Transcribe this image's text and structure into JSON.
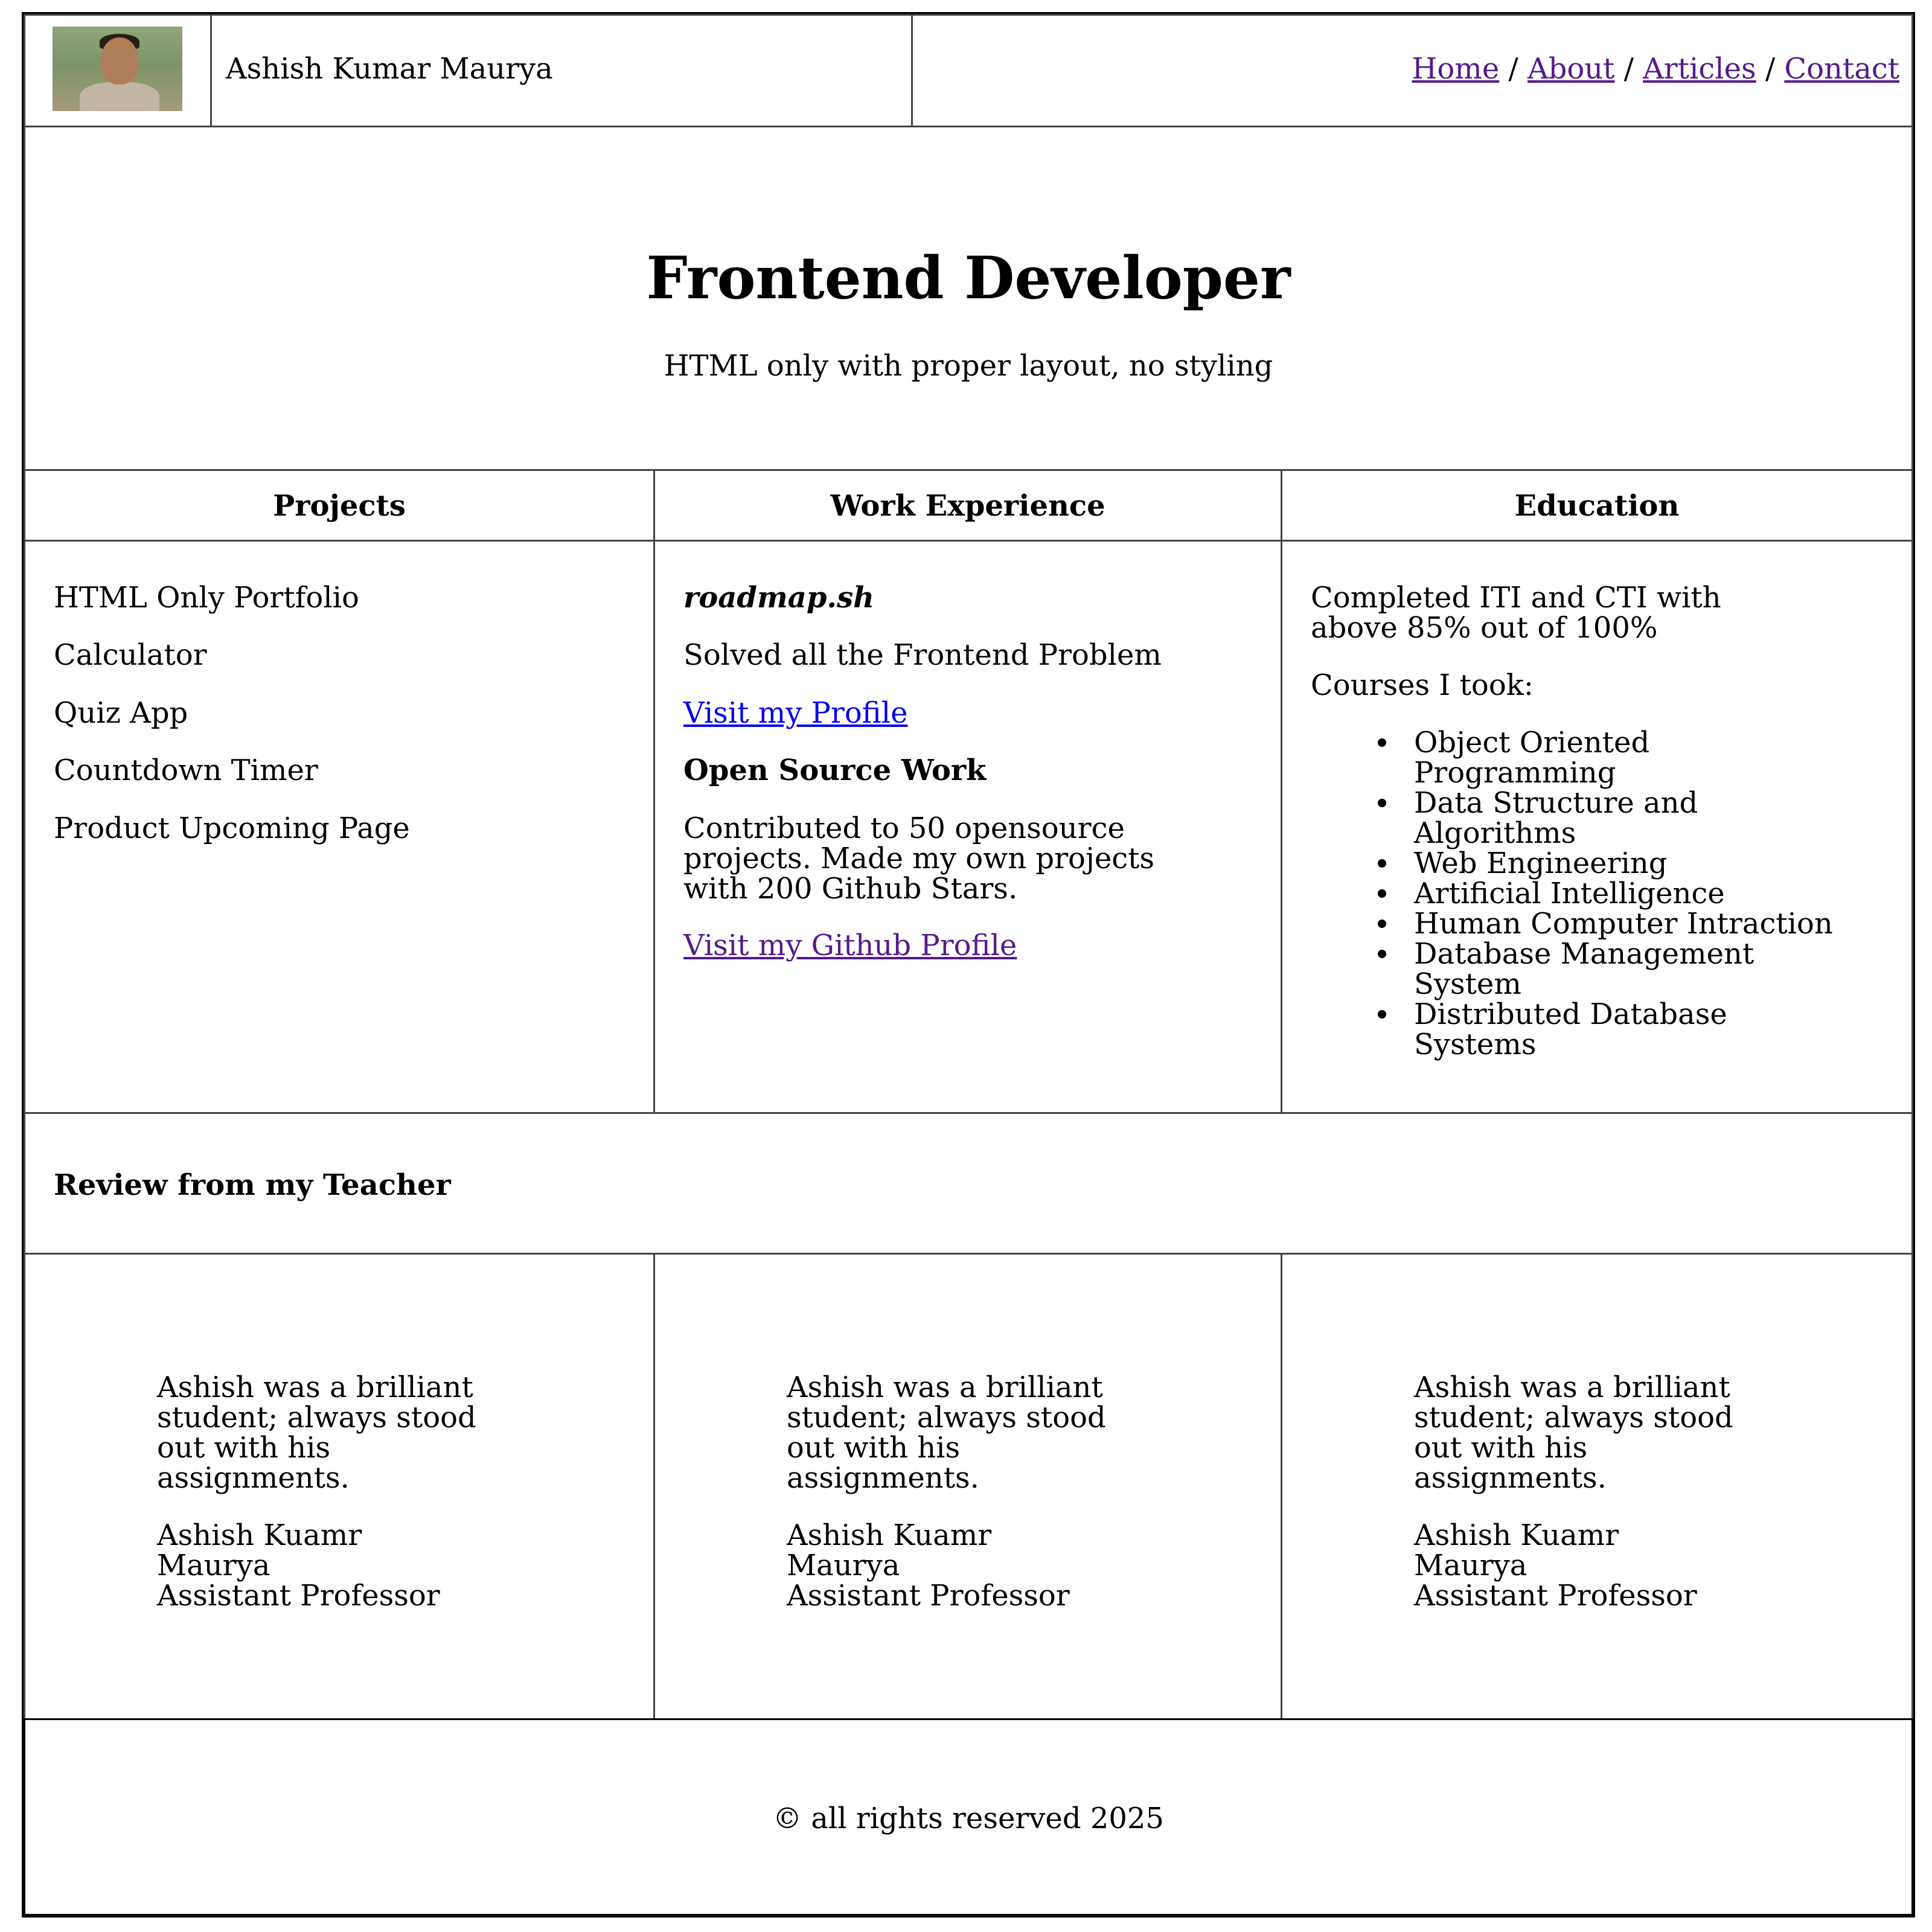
{
  "header": {
    "name": "Ashish Kumar Maurya",
    "nav": [
      {
        "label": "Home"
      },
      {
        "sep": "/"
      },
      {
        "label": "About"
      },
      {
        "sep": "/"
      },
      {
        "label": "Articles"
      },
      {
        "sep": "/"
      },
      {
        "label": "Contact"
      }
    ]
  },
  "hero": {
    "title": "Frontend Developer",
    "subtitle": "HTML only with proper layout, no styling"
  },
  "columns": {
    "projects": {
      "heading": "Projects",
      "items": [
        "HTML Only Portfolio",
        "Calculator",
        "Quiz App",
        "Countdown Timer",
        "Product Upcoming Page"
      ]
    },
    "work": {
      "heading": "Work Experience",
      "company": "roadmap.sh",
      "company_desc": "Solved all the Frontend Problem",
      "profile_link": "Visit my Profile",
      "oss_heading": "Open Source Work",
      "oss_desc_1": "Contributed to 50 opensource",
      "oss_desc_2": "projects. Made my own projects",
      "oss_desc_3": "with 200 Github Stars.",
      "github_link": "Visit my Github Profile"
    },
    "education": {
      "heading": "Education",
      "summary_1": "Completed ITI and CTI with",
      "summary_2": "above 85% out of 100%",
      "courses_label": "Courses I took:",
      "courses": [
        [
          "Object Oriented",
          "Programming"
        ],
        [
          "Data Structure and",
          "Algorithms"
        ],
        [
          "Web Engineering"
        ],
        [
          "Artificial Intelligence"
        ],
        [
          "Human Computer Intraction"
        ],
        [
          "Database Management",
          "System"
        ],
        [
          "Distributed Database",
          "Systems"
        ]
      ]
    }
  },
  "reviews": {
    "heading": "Review from my Teacher",
    "cards": [
      {
        "l1": "Ashish was a brilliant",
        "l2": "student; always stood",
        "l3": "out with his",
        "l4": "assignments.",
        "a1": "Ashish Kuamr",
        "a2": "Maurya",
        "role": "Assistant Professor"
      },
      {
        "l1": "Ashish was a brilliant",
        "l2": "student; always stood",
        "l3": "out with his",
        "l4": "assignments.",
        "a1": "Ashish Kuamr",
        "a2": "Maurya",
        "role": "Assistant Professor"
      },
      {
        "l1": "Ashish was a brilliant",
        "l2": "student; always stood",
        "l3": "out with his",
        "l4": "assignments.",
        "a1": "Ashish Kuamr",
        "a2": "Maurya",
        "role": "Assistant Professor"
      }
    ]
  },
  "footer": {
    "text": "© all rights reserved 2025"
  },
  "colors": {
    "link_visited": "#551a8b",
    "link_unvisited": "#0000ee",
    "border": "#444444"
  }
}
